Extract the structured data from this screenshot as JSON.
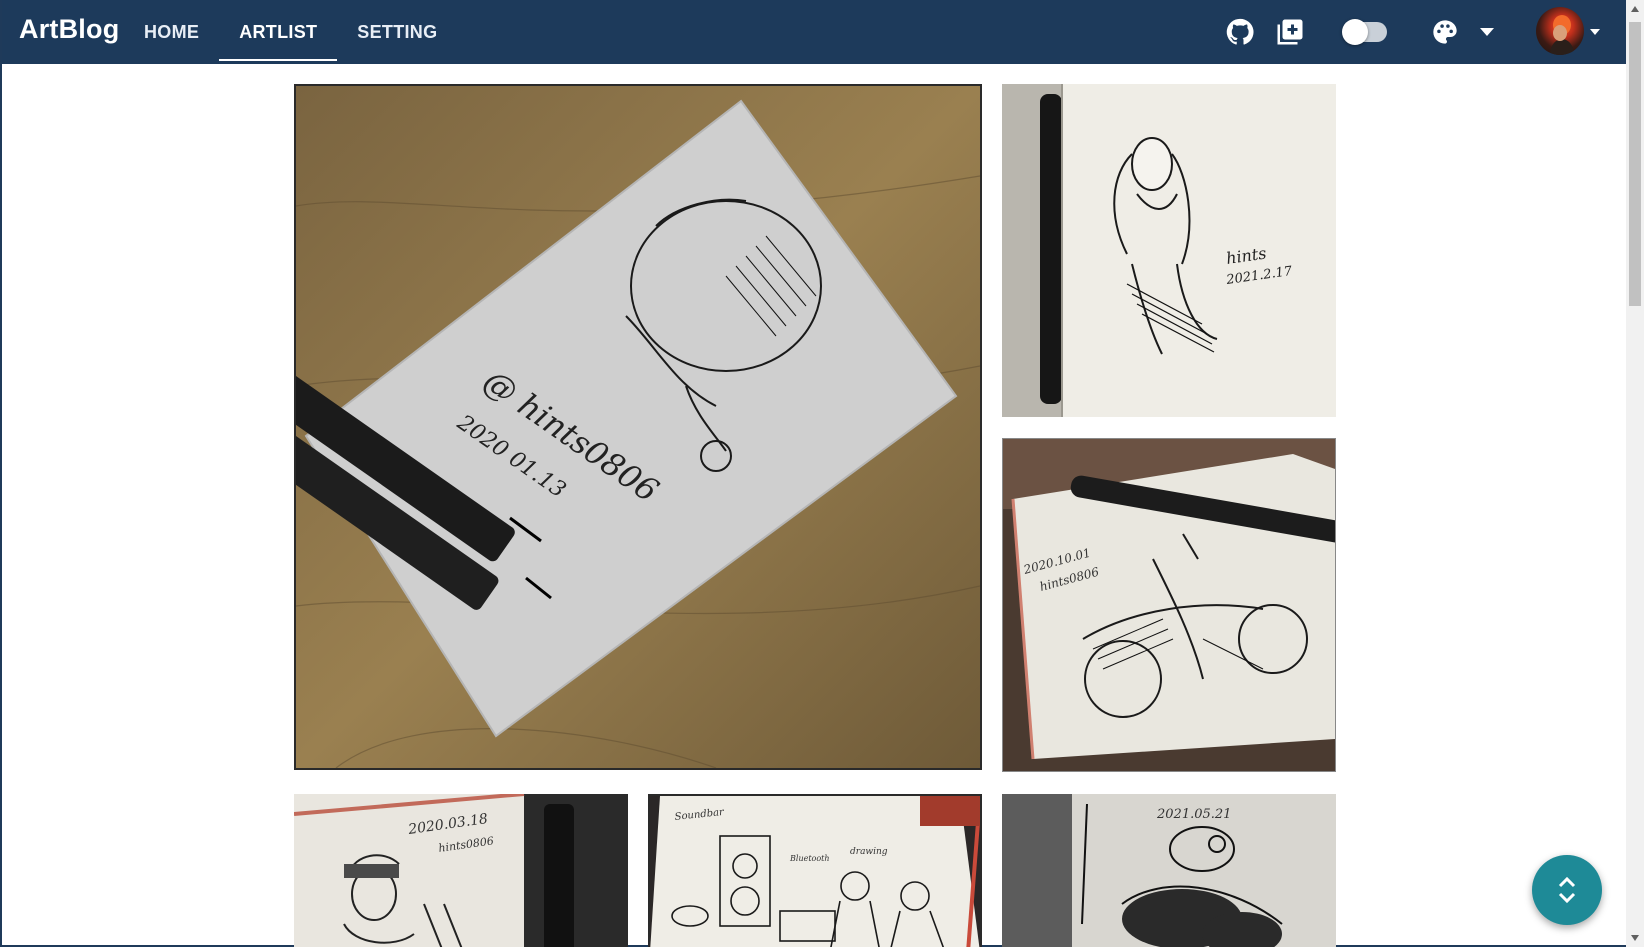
{
  "app": {
    "brand": "ArtBlog"
  },
  "nav": {
    "items": [
      {
        "label": "HOME"
      },
      {
        "label": "ARTLIST"
      },
      {
        "label": "SETTING"
      }
    ],
    "active": "ARTLIST"
  },
  "toolbar": {
    "github_icon": "github-icon",
    "add_icon": "add-box-icon",
    "theme_toggle": "off",
    "palette_icon": "palette-icon"
  },
  "gallery": {
    "artworks": [
      {
        "id": "a1",
        "caption": "@hints0806  2020.01.13"
      },
      {
        "id": "a2",
        "caption": "hints  2021.2.17"
      },
      {
        "id": "a3",
        "caption": "2020.10.01  hints0806"
      },
      {
        "id": "a4",
        "caption": "2020.03.18  hints0806"
      },
      {
        "id": "a5",
        "caption": "Soundbar  Bluetooth  drawing"
      },
      {
        "id": "a6",
        "caption": "2021.05.21"
      }
    ]
  },
  "fab": {
    "icon": "unfold-icon"
  },
  "colors": {
    "navbar": "#1d3a5b",
    "fab": "#1e8a97"
  }
}
